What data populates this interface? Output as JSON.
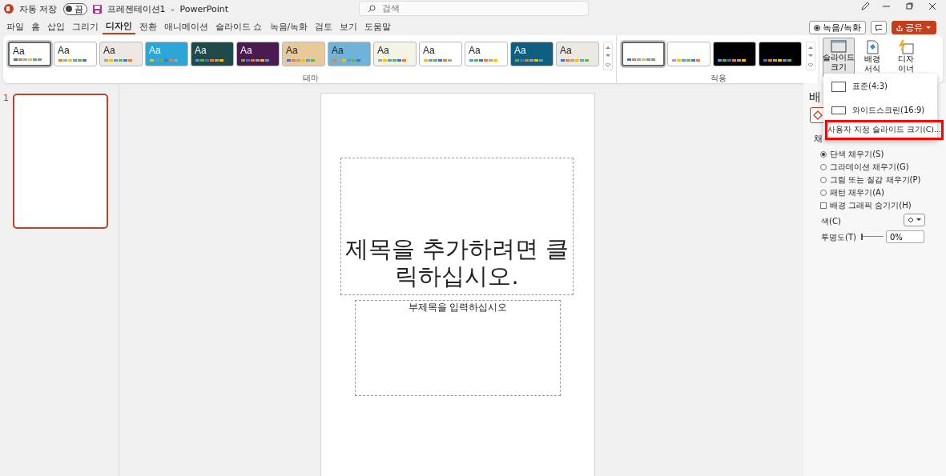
{
  "titlebar": {
    "autosave_label": "자동 저장",
    "autosave_toggle": {
      "text": "끔",
      "on": false
    },
    "title": "프레젠테이션1  -  PowerPoint",
    "search_placeholder": "검색"
  },
  "menu_tabs": [
    {
      "label": "파일",
      "selected": false
    },
    {
      "label": "홈",
      "selected": false
    },
    {
      "label": "삽입",
      "selected": false
    },
    {
      "label": "그리기",
      "selected": false
    },
    {
      "label": "디자인",
      "selected": true
    },
    {
      "label": "전환",
      "selected": false
    },
    {
      "label": "애니메이션",
      "selected": false
    },
    {
      "label": "슬라이드 쇼",
      "selected": false
    },
    {
      "label": "녹음/녹화",
      "selected": false
    },
    {
      "label": "검토",
      "selected": false
    },
    {
      "label": "보기",
      "selected": false
    },
    {
      "label": "도움말",
      "selected": false
    }
  ],
  "header_buttons": {
    "record": "녹음/녹화",
    "share": "공유"
  },
  "themes": {
    "label": "테마",
    "items": [
      {
        "label": "Aa",
        "color": "#ffffff",
        "selected": true
      },
      {
        "label": "Aa",
        "color": "#ffffff",
        "selected": false
      },
      {
        "label": "Aa",
        "color": "#eee8e4",
        "selected": false
      },
      {
        "label": "Aa",
        "color": "#2aa6d8",
        "selected": false
      },
      {
        "label": "Aa",
        "color": "#1f4a4a",
        "selected": false
      },
      {
        "label": "Aa",
        "color": "#4a1a50",
        "selected": false
      },
      {
        "label": "Aa",
        "color": "#e8c99a",
        "selected": false
      },
      {
        "label": "Aa",
        "color": "#6fb3d9",
        "selected": false
      },
      {
        "label": "Aa",
        "color": "#f2f4e6",
        "selected": false
      },
      {
        "label": "Aa",
        "color": "#ffffff",
        "selected": false
      },
      {
        "label": "Aa",
        "color": "#ffffff",
        "selected": false
      },
      {
        "label": "Aa",
        "color": "#0e5f80",
        "selected": false
      },
      {
        "label": "Aa",
        "color": "#ece8e4",
        "selected": false
      }
    ]
  },
  "variants": {
    "label": "적용",
    "items": [
      {
        "color": "#ffffff",
        "selected": true
      },
      {
        "color": "#ffffff",
        "selected": false
      },
      {
        "color": "#000000",
        "selected": false
      },
      {
        "color": "#000000",
        "selected": false
      }
    ]
  },
  "ribbon_buttons": [
    {
      "label": "슬라이드\n크기",
      "pressed": true,
      "kind": "slide-size"
    },
    {
      "label": "배경\n서식",
      "pressed": false,
      "kind": "background"
    },
    {
      "label": "디자\n이너",
      "pressed": false,
      "kind": "designer"
    }
  ],
  "slide_size_menu": [
    {
      "label": "표준(4:3)",
      "kind": "standard"
    },
    {
      "label": "와이드스크린(16:9)",
      "kind": "wide"
    },
    {
      "label": "사용자 지정 슬라이드 크기(C)...",
      "kind": "custom",
      "highlighted": true
    }
  ],
  "thumbnails": [
    {
      "number": "1",
      "selected": true
    }
  ],
  "slide": {
    "title": "제목을 추가하려면 클릭하십시오.",
    "subtitle": "부제목을 입력하십시오"
  },
  "format_pane": {
    "title": "배",
    "section": "채",
    "fill_options": [
      {
        "label": "단색 채우기(S)",
        "kind": "radio",
        "selected": true
      },
      {
        "label": "그라데이션 채우기(G)",
        "kind": "radio",
        "selected": false
      },
      {
        "label": "그림 또는 질감 채우기(P)",
        "kind": "radio",
        "selected": false
      },
      {
        "label": "패턴 채우기(A)",
        "kind": "radio",
        "selected": false
      },
      {
        "label": "배경 그래픽 숨기기(H)",
        "kind": "checkbox",
        "checked": false
      }
    ],
    "color_label": "색(C)",
    "transparency_label": "투명도(T)",
    "transparency": {
      "level": 0,
      "value": "0%"
    }
  }
}
